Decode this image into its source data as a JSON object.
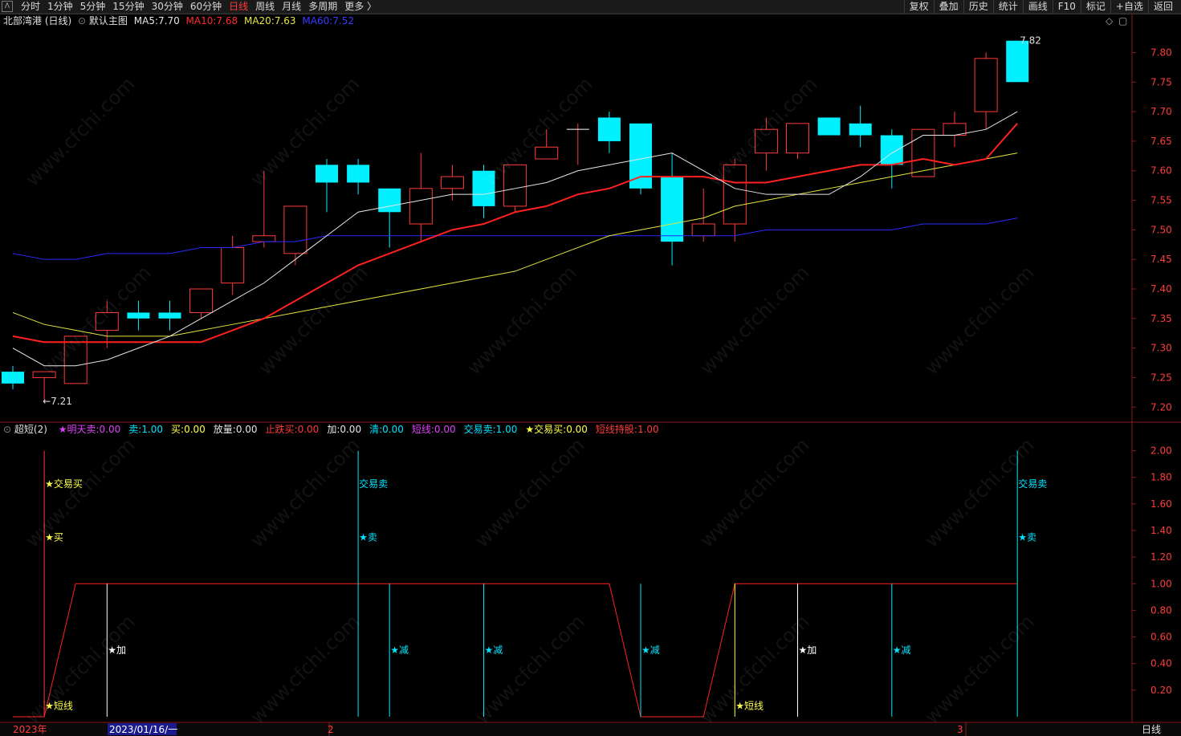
{
  "toolbar": {
    "logo": "Λ",
    "nav": [
      "分时",
      "1分钟",
      "5分钟",
      "15分钟",
      "30分钟",
      "60分钟",
      "日线",
      "周线",
      "月线",
      "多周期",
      "更多 〉"
    ],
    "active": "日线",
    "tools": [
      "复权",
      "叠加",
      "历史",
      "统计",
      "画线",
      "F10",
      "标记",
      "+自选",
      "返回"
    ]
  },
  "main": {
    "stock": "北部湾港 (日线)",
    "template": "默认主图",
    "ma5": {
      "label": "MA5:",
      "value": "7.70",
      "color": "#e6e6e6"
    },
    "ma10": {
      "label": "MA10:",
      "value": "7.68",
      "color": "#ff2a2a"
    },
    "ma20": {
      "label": "MA20:",
      "value": "7.63",
      "color": "#e6e63c"
    },
    "ma60": {
      "label": "MA60:",
      "value": "7.52",
      "color": "#3a3aff"
    },
    "high_label": "7.82",
    "low_label": "←7.21",
    "icons": [
      "diamond-icon",
      "window-icon"
    ]
  },
  "sub": {
    "title": "超短(2)",
    "items": [
      {
        "label": "★明天卖:",
        "value": "0.00",
        "color": "#e040fb"
      },
      {
        "label": "卖:",
        "value": "1.00",
        "color": "#00e5ff"
      },
      {
        "label": "买:",
        "value": "0.00",
        "color": "#ffff4d"
      },
      {
        "label": "放量:",
        "value": "0.00",
        "color": "#e6e6e6"
      },
      {
        "label": "止跌买:",
        "value": "0.00",
        "color": "#ff3b3b"
      },
      {
        "label": "加:",
        "value": "0.00",
        "color": "#e6e6e6"
      },
      {
        "label": "清:",
        "value": "0.00",
        "color": "#00e5ff"
      },
      {
        "label": "短线:",
        "value": "0.00",
        "color": "#e040fb"
      },
      {
        "label": "交易卖:",
        "value": "1.00",
        "color": "#00e5ff"
      },
      {
        "label": "★交易买:",
        "value": "0.00",
        "color": "#ffff4d"
      },
      {
        "label": "短线持股:",
        "value": "1.00",
        "color": "#ff3b3b"
      }
    ],
    "signals": {
      "trade_buy": "★交易买",
      "buy": "★买",
      "short": "★短线",
      "add": "★加",
      "trade_sell": "交易卖",
      "sell": "★卖",
      "reduce": "★减"
    }
  },
  "xaxis": {
    "labels": [
      "2023年",
      "2023/01/16/一",
      "2",
      "3"
    ],
    "period": "日线"
  },
  "watermark": "www.cfchi.com",
  "chart_data": {
    "type": "candlestick",
    "ylim": [
      7.18,
      7.84
    ],
    "yticks": [
      "7.80",
      "7.75",
      "7.70",
      "7.65",
      "7.60",
      "7.55",
      "7.50",
      "7.45",
      "7.40",
      "7.35",
      "7.30",
      "7.25",
      "7.20"
    ],
    "candles": [
      {
        "o": 7.26,
        "c": 7.24,
        "h": 7.27,
        "l": 7.23
      },
      {
        "o": 7.25,
        "c": 7.26,
        "h": 7.26,
        "l": 7.21
      },
      {
        "o": 7.24,
        "c": 7.32,
        "h": 7.32,
        "l": 7.24
      },
      {
        "o": 7.33,
        "c": 7.36,
        "h": 7.38,
        "l": 7.3
      },
      {
        "o": 7.36,
        "c": 7.35,
        "h": 7.38,
        "l": 7.33
      },
      {
        "o": 7.36,
        "c": 7.35,
        "h": 7.38,
        "l": 7.33
      },
      {
        "o": 7.36,
        "c": 7.4,
        "h": 7.4,
        "l": 7.35
      },
      {
        "o": 7.41,
        "c": 7.47,
        "h": 7.49,
        "l": 7.39
      },
      {
        "o": 7.48,
        "c": 7.49,
        "h": 7.6,
        "l": 7.47
      },
      {
        "o": 7.46,
        "c": 7.54,
        "h": 7.54,
        "l": 7.44
      },
      {
        "o": 7.61,
        "c": 7.58,
        "h": 7.62,
        "l": 7.53
      },
      {
        "o": 7.61,
        "c": 7.58,
        "h": 7.62,
        "l": 7.56
      },
      {
        "o": 7.57,
        "c": 7.53,
        "h": 7.57,
        "l": 7.47
      },
      {
        "o": 7.51,
        "c": 7.57,
        "h": 7.63,
        "l": 7.48
      },
      {
        "o": 7.57,
        "c": 7.59,
        "h": 7.61,
        "l": 7.55
      },
      {
        "o": 7.6,
        "c": 7.54,
        "h": 7.61,
        "l": 7.52
      },
      {
        "o": 7.54,
        "c": 7.61,
        "h": 7.61,
        "l": 7.53
      },
      {
        "o": 7.62,
        "c": 7.64,
        "h": 7.67,
        "l": 7.62
      },
      {
        "o": 7.67,
        "c": 7.67,
        "h": 7.68,
        "l": 7.61
      },
      {
        "o": 7.69,
        "c": 7.65,
        "h": 7.7,
        "l": 7.63
      },
      {
        "o": 7.68,
        "c": 7.57,
        "h": 7.68,
        "l": 7.56
      },
      {
        "o": 7.59,
        "c": 7.48,
        "h": 7.63,
        "l": 7.44
      },
      {
        "o": 7.49,
        "c": 7.51,
        "h": 7.57,
        "l": 7.48
      },
      {
        "o": 7.51,
        "c": 7.61,
        "h": 7.62,
        "l": 7.48
      },
      {
        "o": 7.63,
        "c": 7.67,
        "h": 7.69,
        "l": 7.6
      },
      {
        "o": 7.63,
        "c": 7.68,
        "h": 7.68,
        "l": 7.62
      },
      {
        "o": 7.69,
        "c": 7.66,
        "h": 7.69,
        "l": 7.66
      },
      {
        "o": 7.68,
        "c": 7.66,
        "h": 7.71,
        "l": 7.64
      },
      {
        "o": 7.66,
        "c": 7.61,
        "h": 7.67,
        "l": 7.57
      },
      {
        "o": 7.59,
        "c": 7.67,
        "h": 7.67,
        "l": 7.59
      },
      {
        "o": 7.66,
        "c": 7.68,
        "h": 7.7,
        "l": 7.64
      },
      {
        "o": 7.7,
        "c": 7.79,
        "h": 7.8,
        "l": 7.67
      },
      {
        "o": 7.82,
        "c": 7.75,
        "h": 7.82,
        "l": 7.75
      }
    ],
    "ma5": [
      7.3,
      7.27,
      7.27,
      7.28,
      7.3,
      7.32,
      7.35,
      7.38,
      7.41,
      7.45,
      7.49,
      7.53,
      7.54,
      7.55,
      7.56,
      7.56,
      7.57,
      7.58,
      7.6,
      7.61,
      7.62,
      7.63,
      7.6,
      7.57,
      7.56,
      7.56,
      7.56,
      7.59,
      7.63,
      7.66,
      7.66,
      7.67,
      7.7
    ],
    "ma10": [
      7.32,
      7.31,
      7.31,
      7.31,
      7.31,
      7.31,
      7.31,
      7.33,
      7.35,
      7.38,
      7.41,
      7.44,
      7.46,
      7.48,
      7.5,
      7.51,
      7.53,
      7.54,
      7.56,
      7.57,
      7.59,
      7.59,
      7.59,
      7.58,
      7.58,
      7.59,
      7.6,
      7.61,
      7.61,
      7.62,
      7.61,
      7.62,
      7.68
    ],
    "ma20": [
      7.36,
      7.34,
      7.33,
      7.32,
      7.32,
      7.32,
      7.33,
      7.34,
      7.35,
      7.36,
      7.37,
      7.38,
      7.39,
      7.4,
      7.41,
      7.42,
      7.43,
      7.45,
      7.47,
      7.49,
      7.5,
      7.51,
      7.52,
      7.54,
      7.55,
      7.56,
      7.57,
      7.58,
      7.59,
      7.6,
      7.61,
      7.62,
      7.63
    ],
    "ma60": [
      7.46,
      7.45,
      7.45,
      7.46,
      7.46,
      7.46,
      7.47,
      7.47,
      7.48,
      7.48,
      7.49,
      7.49,
      7.49,
      7.49,
      7.49,
      7.49,
      7.49,
      7.49,
      7.49,
      7.49,
      7.49,
      7.49,
      7.49,
      7.49,
      7.5,
      7.5,
      7.5,
      7.5,
      7.5,
      7.51,
      7.51,
      7.51,
      7.52
    ],
    "indicator": {
      "ylim": [
        0,
        2.1
      ],
      "yticks": [
        "2.00",
        "1.80",
        "1.60",
        "1.40",
        "1.20",
        "1.00",
        "0.80",
        "0.60",
        "0.40",
        "0.20"
      ],
      "hold": [
        0,
        0,
        1,
        1,
        1,
        1,
        1,
        1,
        1,
        1,
        1,
        1,
        1,
        1,
        1,
        1,
        1,
        1,
        1,
        1,
        0,
        0,
        0,
        1,
        1,
        1,
        1,
        1,
        1,
        1,
        1,
        1,
        1
      ],
      "events": [
        {
          "i": 1,
          "label": "trade_buy",
          "y": 1.75,
          "color": "#ffff4d"
        },
        {
          "i": 1,
          "label": "buy",
          "y": 1.35,
          "color": "#ffff4d"
        },
        {
          "i": 1,
          "label": "short",
          "y": 0.08,
          "color": "#ffff4d"
        },
        {
          "i": 3,
          "label": "add",
          "y": 0.5,
          "color": "#ffffff"
        },
        {
          "i": 11,
          "label": "trade_sell",
          "y": 1.75,
          "color": "#00e5ff"
        },
        {
          "i": 11,
          "label": "sell",
          "y": 1.35,
          "color": "#00e5ff"
        },
        {
          "i": 12,
          "label": "reduce",
          "y": 0.5,
          "color": "#00e5ff"
        },
        {
          "i": 15,
          "label": "reduce",
          "y": 0.5,
          "color": "#00e5ff"
        },
        {
          "i": 20,
          "label": "reduce",
          "y": 0.5,
          "color": "#00e5ff"
        },
        {
          "i": 23,
          "label": "short",
          "y": 0.08,
          "color": "#ffff4d"
        },
        {
          "i": 25,
          "label": "add",
          "y": 0.5,
          "color": "#ffffff"
        },
        {
          "i": 28,
          "label": "reduce",
          "y": 0.5,
          "color": "#00e5ff"
        },
        {
          "i": 32,
          "label": "trade_sell",
          "y": 1.75,
          "color": "#00e5ff"
        },
        {
          "i": 32,
          "label": "sell",
          "y": 1.35,
          "color": "#00e5ff"
        }
      ],
      "vlines": [
        {
          "i": 1,
          "color": "#ff3b3b",
          "top": 2.0
        },
        {
          "i": 3,
          "color": "#ffffff",
          "top": 1.0
        },
        {
          "i": 11,
          "color": "#00e5ff",
          "top": 2.0
        },
        {
          "i": 12,
          "color": "#00e5ff",
          "top": 1.0
        },
        {
          "i": 15,
          "color": "#00e5ff",
          "top": 1.0
        },
        {
          "i": 20,
          "color": "#00e5ff",
          "top": 1.0
        },
        {
          "i": 23,
          "color": "#ffff4d",
          "top": 1.0
        },
        {
          "i": 25,
          "color": "#ffffff",
          "top": 1.0
        },
        {
          "i": 28,
          "color": "#00e5ff",
          "top": 1.0
        },
        {
          "i": 32,
          "color": "#00e5ff",
          "top": 2.0
        }
      ]
    }
  }
}
